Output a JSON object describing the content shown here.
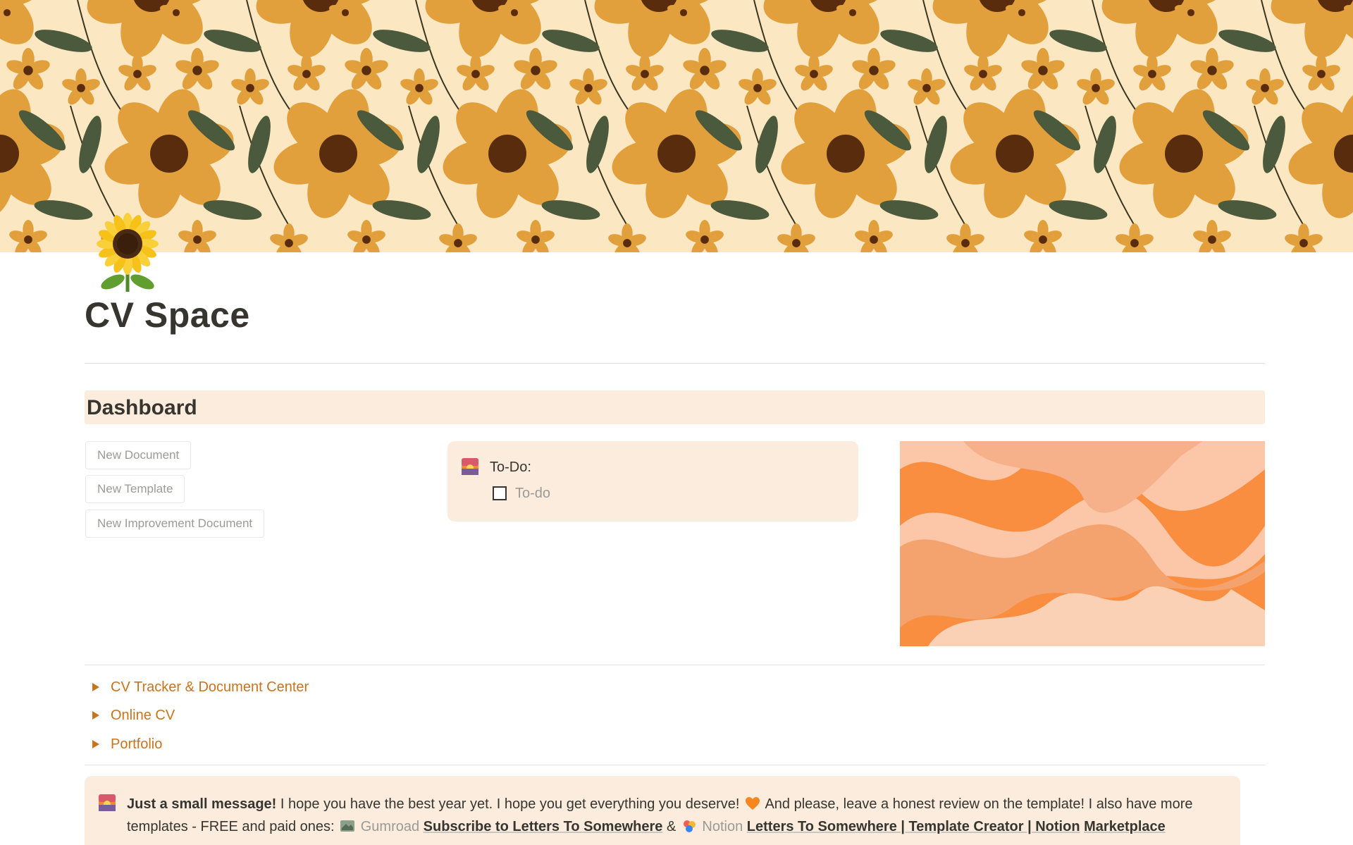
{
  "page": {
    "title": "CV Space",
    "icon": "sunflower-icon"
  },
  "dashboard": {
    "heading": "Dashboard",
    "buttons": [
      {
        "label": "New Document"
      },
      {
        "label": "New Template"
      },
      {
        "label": "New Improvement Document"
      }
    ],
    "todo": {
      "icon": "sunset-icon",
      "title": "To-Do:",
      "item_placeholder": "To-do",
      "checked": false
    }
  },
  "toggles": [
    {
      "label": "CV Tracker & Document Center"
    },
    {
      "label": "Online CV"
    },
    {
      "label": "Portfolio"
    }
  ],
  "message": {
    "icon": "sunset-icon",
    "bold": "Just a small message!",
    "text1": "I hope you have the best year yet. I hope you get everything you deserve!",
    "heart_icon": "orange-heart-icon",
    "text2": "And please, leave a honest review on the template! I also have more templates - FREE and paid ones:",
    "gumroad_icon": "gumroad-icon",
    "gumroad_label": "Gumroad",
    "gumroad_link": "Subscribe to Letters To Somewhere",
    "ampersand": "&",
    "notion_icon": "notion-icon",
    "notion_label": "Notion",
    "notion_link": "Letters To Somewhere | Template Creator | Notion",
    "notion_link_cont": "Marketplace"
  },
  "colors": {
    "accent": "#c7741c",
    "callout_bg": "#fbecdd",
    "cover_bg": "#fbe8c2",
    "flower": "#e1a03c",
    "flower_center": "#5a2c0e",
    "leaf": "#4b5a3c"
  }
}
